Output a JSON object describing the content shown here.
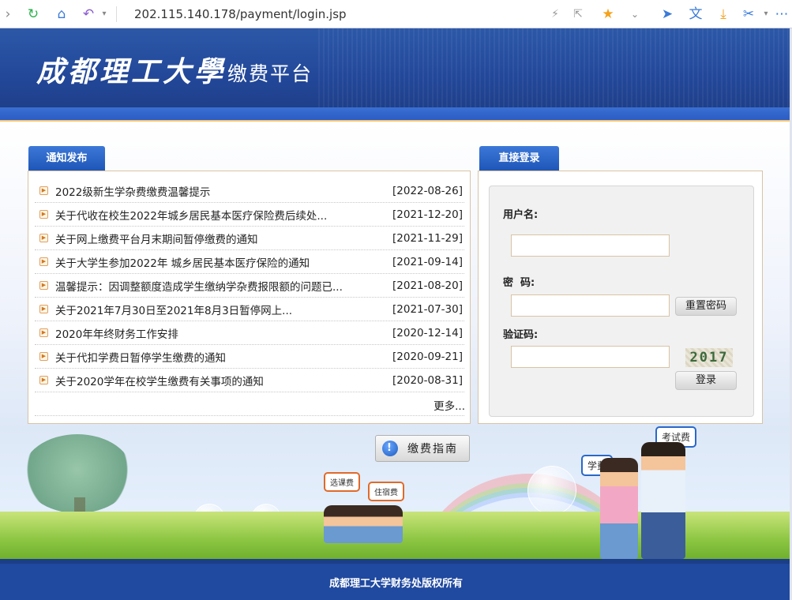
{
  "browser": {
    "url": "202.115.140.178/payment/login.jsp"
  },
  "header": {
    "university_logo": "成都理工大學",
    "site_title": "缴费平台"
  },
  "notices": {
    "tab_label": "通知发布",
    "items": [
      {
        "title": "2022级新生学杂费缴费温馨提示",
        "date": "[2022-08-26]"
      },
      {
        "title": "关于代收在校生2022年城乡居民基本医疗保险费后续处...",
        "date": "[2021-12-20]"
      },
      {
        "title": "关于网上缴费平台月末期间暂停缴费的通知",
        "date": "[2021-11-29]"
      },
      {
        "title": "关于大学生参加2022年 城乡居民基本医疗保险的通知",
        "date": "[2021-09-14]"
      },
      {
        "title": "温馨提示：因调整额度造成学生缴纳学杂费报限额的问题已...",
        "date": "[2021-08-20]"
      },
      {
        "title": "关于2021年7月30日至2021年8月3日暂停网上...",
        "date": "[2021-07-30]"
      },
      {
        "title": "2020年年终财务工作安排",
        "date": "[2020-12-14]"
      },
      {
        "title": "关于代扣学费日暂停学生缴费的通知",
        "date": "[2020-09-21]"
      },
      {
        "title": "关于2020学年在校学生缴费有关事项的通知",
        "date": "[2020-08-31]"
      }
    ],
    "more_label": "更多..."
  },
  "login": {
    "tab_label": "直接登录",
    "username_label": "用户名:",
    "password_label": "密  码:",
    "captcha_label": "验证码:",
    "reset_password_label": "重置密码",
    "captcha_image_text": "2017",
    "login_label": "登录"
  },
  "guide": {
    "label": "缴费指南"
  },
  "scenery": {
    "bubble_fee_select": "选课费",
    "bubble_fee_dorm": "住宿费",
    "bubble_tuition": "学费",
    "bubble_exam": "考试费"
  },
  "footer": {
    "copyright": "成都理工大学财务处版权所有"
  },
  "colors": {
    "header_blue": "#2c58a8",
    "tab_blue": "#1d55b6",
    "footer_blue": "#2049a0",
    "input_border": "#d8c3a5"
  }
}
